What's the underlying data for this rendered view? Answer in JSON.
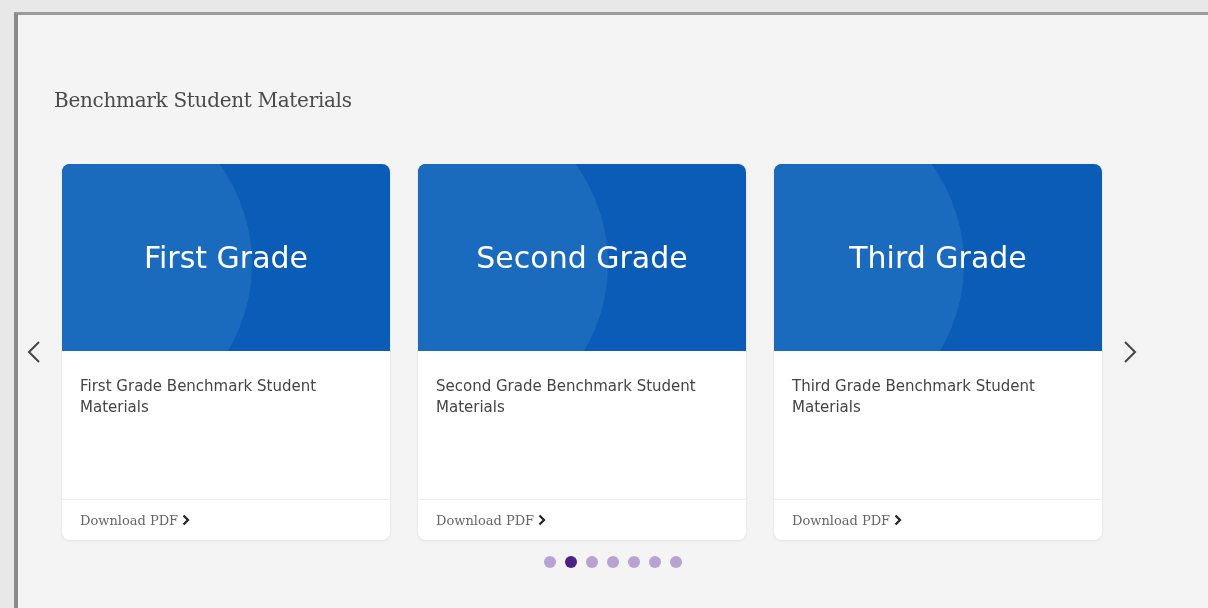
{
  "section_title": "Benchmark Student Materials",
  "cards": [
    {
      "banner": "First Grade",
      "title": "First Grade Benchmark Student Materials",
      "link": "Download PDF"
    },
    {
      "banner": "Second Grade",
      "title": "Second Grade Benchmark Student Materials",
      "link": "Download PDF"
    },
    {
      "banner": "Third Grade",
      "title": "Third Grade Benchmark Student Materials",
      "link": "Download PDF"
    }
  ],
  "dots": [
    {
      "selected": false
    },
    {
      "selected": true
    },
    {
      "selected": false
    },
    {
      "selected": false
    },
    {
      "selected": false
    },
    {
      "selected": false
    },
    {
      "selected": false
    }
  ]
}
